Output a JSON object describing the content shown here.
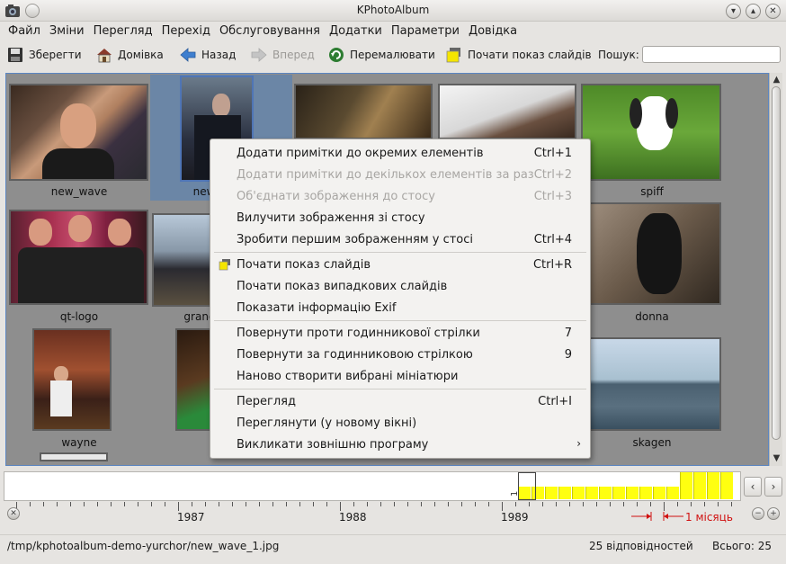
{
  "window": {
    "title": "KPhotoAlbum"
  },
  "menubar": [
    "Файл",
    "Зміни",
    "Перегляд",
    "Перехід",
    "Обслуговування",
    "Додатки",
    "Параметри",
    "Довідка"
  ],
  "toolbar": {
    "save": "Зберегти",
    "home": "Домівка",
    "back": "Назад",
    "forward": "Вперед",
    "redraw": "Перемалювати",
    "slideshow": "Почати показ слайдів",
    "search_label": "Пошук:",
    "search_value": ""
  },
  "thumbnails": [
    {
      "name": "new_wave"
    },
    {
      "name": "new_wave_1",
      "visible_caption": "new"
    },
    {
      "name": ""
    },
    {
      "name": ""
    },
    {
      "name": "spiff"
    },
    {
      "name": "qt-logo"
    },
    {
      "name": "grand",
      "visible_caption": "grand"
    },
    {
      "name": "donna"
    },
    {
      "name": "wayne"
    },
    {
      "name": "skagen"
    }
  ],
  "context_menu": [
    {
      "label": "Додати примітки до окремих елементів",
      "shortcut": "Ctrl+1",
      "enabled": true
    },
    {
      "label": "Додати примітки до декількох елементів за раз",
      "shortcut": "Ctrl+2",
      "enabled": false
    },
    {
      "label": "Об'єднати зображення до стосу",
      "shortcut": "Ctrl+3",
      "enabled": false
    },
    {
      "label": "Вилучити зображення зі стосу",
      "shortcut": "",
      "enabled": true
    },
    {
      "label": "Зробити першим зображенням у стосі",
      "shortcut": "Ctrl+4",
      "enabled": true
    },
    {
      "label": "Почати показ слайдів",
      "shortcut": "Ctrl+R",
      "enabled": true
    },
    {
      "label": "Почати показ випадкових слайдів",
      "shortcut": "",
      "enabled": true
    },
    {
      "label": "Показати інформацію Exif",
      "shortcut": "",
      "enabled": true
    },
    {
      "label": "Повернути проти годинникової стрілки",
      "shortcut": "7",
      "enabled": true
    },
    {
      "label": "Повернути за годинниковою стрілкою",
      "shortcut": "9",
      "enabled": true
    },
    {
      "label": "Наново створити вибрані мініатюри",
      "shortcut": "",
      "enabled": true
    },
    {
      "label": "Перегляд",
      "shortcut": "Ctrl+I",
      "enabled": true
    },
    {
      "label": "Переглянути (у новому вікні)",
      "shortcut": "",
      "enabled": true
    },
    {
      "label": "Викликати зовнішню програму",
      "shortcut": "",
      "enabled": true
    }
  ],
  "timeline": {
    "years": [
      "1987",
      "1988",
      "1989"
    ],
    "bar_values": [
      "1",
      "1",
      "1",
      "1",
      "1",
      "1",
      "1",
      "1",
      "1",
      "1",
      "1",
      "1",
      "2",
      "2",
      "2",
      "2"
    ],
    "scale_label": "1 місяць"
  },
  "statusbar": {
    "path": "/tmp/kphotoalbum-demo-yurchor/new_wave_1.jpg",
    "matches": "25 відповідностей",
    "total": "Всього: 25"
  },
  "colors": {
    "selection": "#6b86a6",
    "timeline_bar": "#ffff10",
    "background": "#8e8e8e"
  }
}
